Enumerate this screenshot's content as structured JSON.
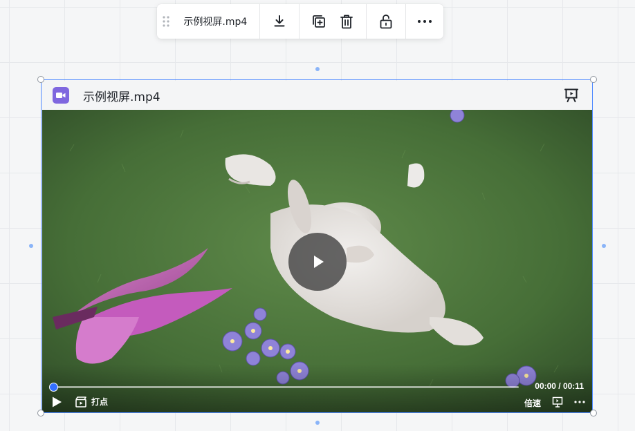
{
  "toolbar": {
    "filename": "示例视屏.mp4",
    "icons": [
      "drag-handle-icon",
      "download-icon",
      "copy-icon",
      "delete-icon",
      "unlock-icon",
      "more-icon"
    ]
  },
  "card": {
    "title": "示例视屏.mp4",
    "file_icon": "video-file-icon",
    "header_action_icon": "present-icon"
  },
  "player": {
    "time_display": "00:00 / 00:11",
    "progress": 0,
    "mark_label": "打点",
    "speed_label": "倍速",
    "accent_color": "#3370ff"
  }
}
